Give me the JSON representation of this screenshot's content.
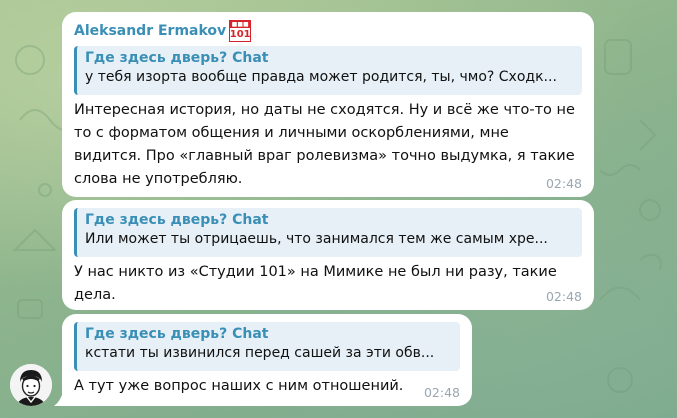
{
  "chat": {
    "sender_name": "Aleksandr Ermakov",
    "sender_badge": "101",
    "messages": [
      {
        "reply_title": "Где здесь дверь? Chat",
        "reply_text": "у тебя изорта вообще правда может родится, ты, чмо? Сходк...",
        "text_lines": [
          "Интересная история, но даты не сходятся. Ну и всё же что-то не",
          "то с форматом общения и личными оскорблениями, мне",
          "видится. Про «главный враг ролевизма» точно выдумка, я такие",
          "слова не употребляю."
        ],
        "time": "02:48"
      },
      {
        "reply_title": "Где здесь дверь? Chat",
        "reply_text": "Или может ты отрицаешь, что занимался тем же самым хре...",
        "text_lines": [
          "У нас никто из «Студии 101» на Мимике не был ни разу, такие",
          "дела."
        ],
        "time": "02:48"
      },
      {
        "reply_title": "Где здесь дверь? Chat",
        "reply_text": "кстати ты извинился перед сашей за эти обв...",
        "text_lines": [
          "А тут уже вопрос наших с ним отношений."
        ],
        "time": "02:48"
      }
    ]
  }
}
